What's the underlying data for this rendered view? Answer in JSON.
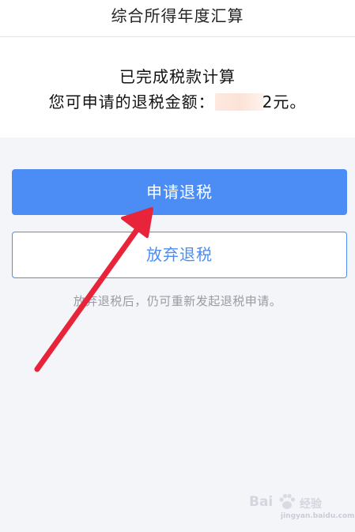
{
  "header": {
    "title": "综合所得年度汇算"
  },
  "result": {
    "status": "已完成税款计算",
    "refund_label": "您可申请的退税金额：",
    "refund_amount_visible_tail": "2元。"
  },
  "actions": {
    "apply_label": "申请退税",
    "abandon_label": "放弃退税"
  },
  "hint": "放弃退税后，仍可重新发起退税申请。",
  "watermark": {
    "brand_prefix": "Bai",
    "brand_suffix": "经验",
    "url": "jingyan.baidu.com"
  },
  "colors": {
    "primary": "#4b8df5",
    "annotation_arrow": "#e8243a",
    "page_background": "#f4f5f9"
  }
}
